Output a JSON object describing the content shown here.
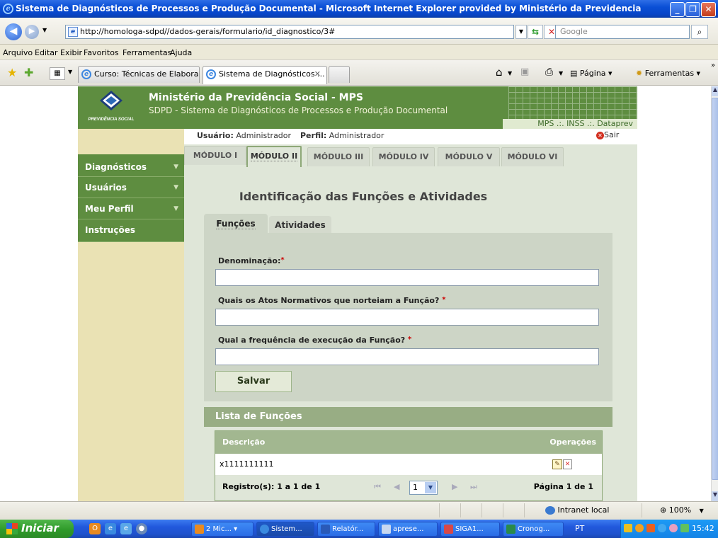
{
  "window": {
    "title": "Sistema de Diagnósticos de Processos e Produção Documental - Microsoft Internet Explorer provided by Ministério da Previdencia"
  },
  "addressbar": {
    "url": "http://homologa-sdpd//dados-gerais/formulario/id_diagnostico/3#",
    "search_placeholder": "Google"
  },
  "menu": [
    "Arquivo",
    "Editar",
    "Exibir",
    "Favoritos",
    "Ferramentas",
    "Ajuda"
  ],
  "tabs": [
    {
      "label": "Curso: Técnicas de Elaboraç..."
    },
    {
      "label": "Sistema de Diagnósticos ...",
      "close": "✕"
    }
  ],
  "toolbar": {
    "page": "Página",
    "tools": "Ferramentas"
  },
  "site": {
    "logo_text": "PREVIDÊNCIA SOCIAL",
    "title": "Ministério da Previdência Social - MPS",
    "subtitle": "SDPD - Sistema de Diagnósticos de Processos e Produção Documental",
    "links": "MPS .:. INSS .:. Dataprev"
  },
  "userbar": {
    "user_label": "Usuário:",
    "user_value": "Administrador",
    "profile_label": "Perfil:",
    "profile_value": "Administrador",
    "logout": "Sair"
  },
  "sidebar": [
    {
      "label": "Diagnósticos",
      "arrow": "▼"
    },
    {
      "label": "Usuários",
      "arrow": "▼"
    },
    {
      "label": "Meu Perfil",
      "arrow": "▼"
    },
    {
      "label": "Instruções",
      "arrow": ""
    }
  ],
  "modules": [
    "MÓDULO I",
    "MÓDULO II",
    "MÓDULO III",
    "MÓDULO IV",
    "MÓDULO V",
    "MÓDULO VI"
  ],
  "active_module": "MÓDULO II",
  "page_title": "Identificação das Funções e Atividades",
  "form_tabs": [
    "Funções",
    "Atividades"
  ],
  "form": {
    "fields": [
      {
        "label": "Denominação:",
        "required": "*",
        "value": ""
      },
      {
        "label": "Quais os Atos Normativos que norteiam a Função?",
        "required": "*",
        "value": ""
      },
      {
        "label": "Qual a frequência de execução da Função?",
        "required": "*",
        "value": ""
      }
    ],
    "save_label": "Salvar"
  },
  "list": {
    "title": "Lista de Funções",
    "columns": [
      "Descrição",
      "Operações"
    ],
    "rows": [
      {
        "descricao": "x1111111111"
      }
    ],
    "pager": {
      "records": "Registro(s): 1 a 1 de 1",
      "page_select": "1",
      "page_info": "Página 1 de 1"
    }
  },
  "statusbar": {
    "zone": "Intranet local",
    "zoom": "100%"
  },
  "taskbar": {
    "start": "Iniciar",
    "tasks": [
      "2 Mic...",
      "Sistem...",
      "Relatór...",
      "aprese...",
      "SIGA1...",
      "Cronog..."
    ],
    "lang": "PT",
    "clock": "15:42"
  },
  "colors": {
    "header_green": "#5e8d40",
    "sidebar_tan": "#eae2b4",
    "content_bg": "#dfe6d8",
    "required_red": "#cc0000"
  }
}
